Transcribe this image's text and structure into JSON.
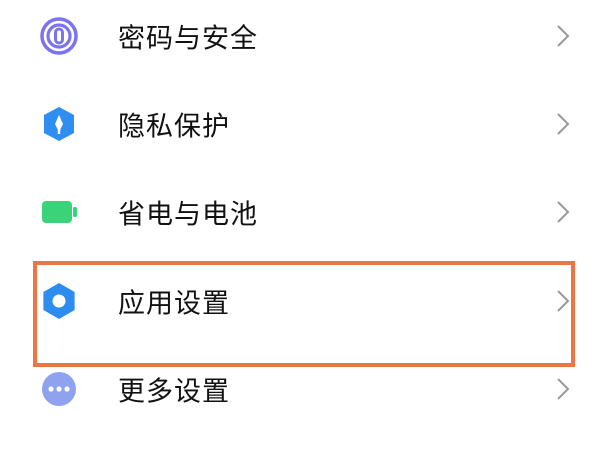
{
  "settings": {
    "items": [
      {
        "label": "密码与安全",
        "icon": "fingerprint-icon",
        "icon_color": "#7b73f2"
      },
      {
        "label": "隐私保护",
        "icon": "privacy-shield-icon",
        "icon_color": "#2f8ff0"
      },
      {
        "label": "省电与电池",
        "icon": "battery-icon",
        "icon_color": "#3ad37a"
      },
      {
        "label": "应用设置",
        "icon": "gear-icon",
        "icon_color": "#2d8cf0"
      },
      {
        "label": "更多设置",
        "icon": "more-dots-icon",
        "icon_color": "#8fa2f0"
      }
    ],
    "highlight_color": "#ed7545",
    "chevron_color": "#9a9a9a"
  }
}
